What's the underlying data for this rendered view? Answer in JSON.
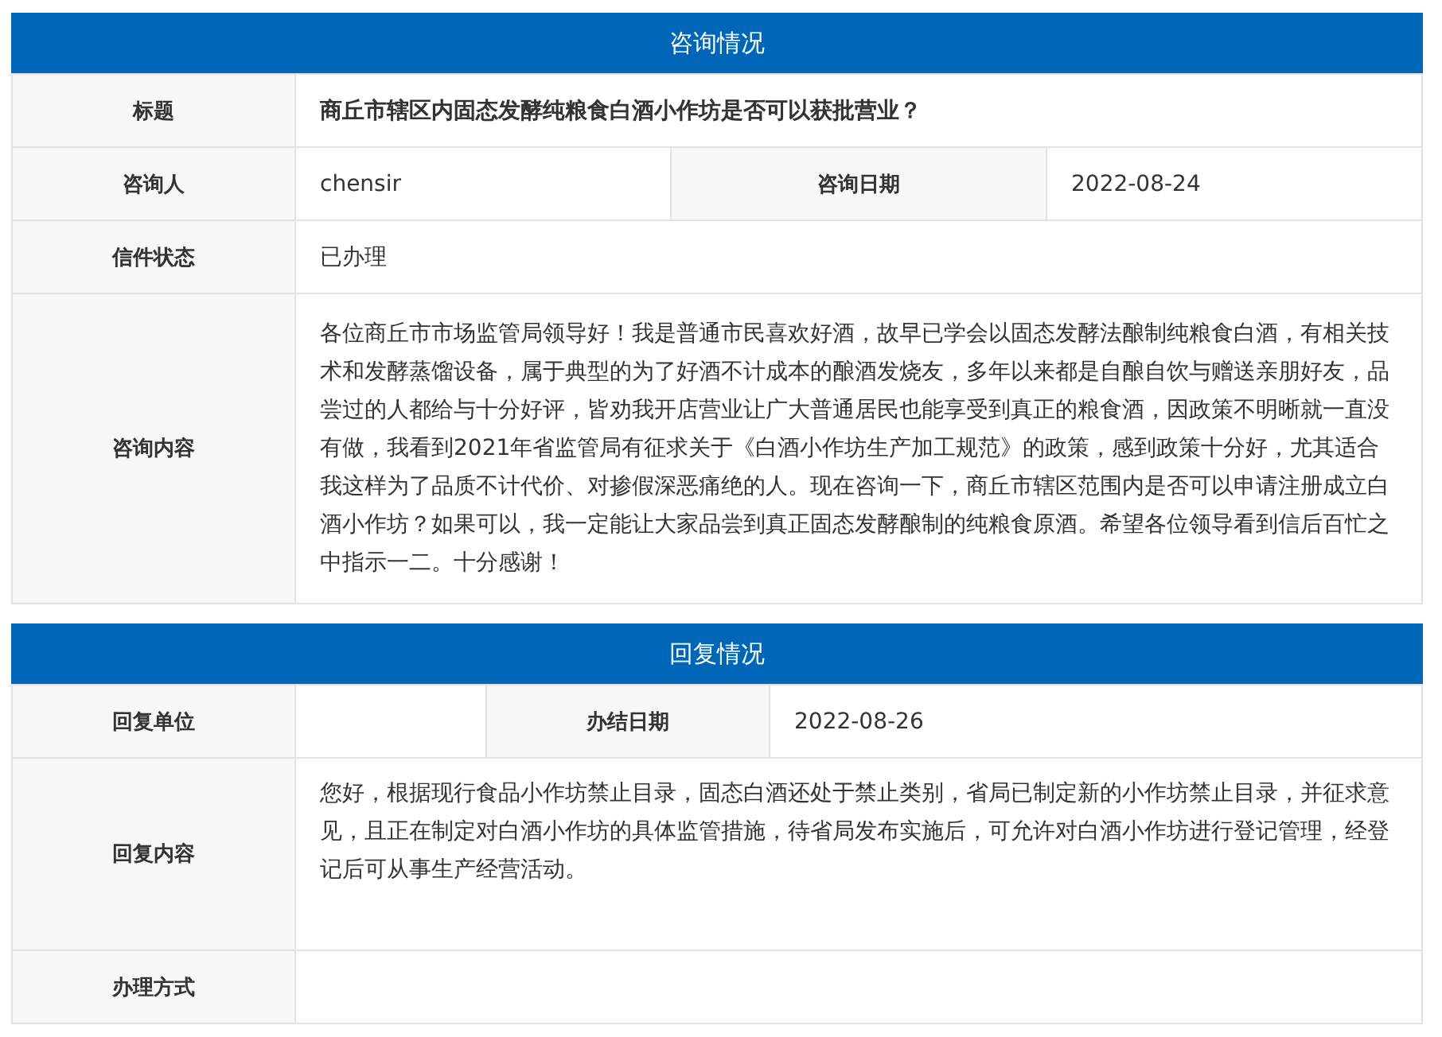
{
  "sections": [
    {
      "title": "咨询情况",
      "rows": [
        {
          "cells": [
            {
              "label": "标题",
              "value": "商丘市辖区内固态发酵纯粮食白酒小作坊是否可以获批营业？",
              "bold": true
            }
          ]
        },
        {
          "cells": [
            {
              "label": "咨询人",
              "value": "chensir"
            },
            {
              "label": "咨询日期",
              "value": "2022-08-24"
            }
          ]
        },
        {
          "cells": [
            {
              "label": "信件状态",
              "value": "已办理"
            }
          ]
        },
        {
          "cells": [
            {
              "label": "咨询内容",
              "value": "各位商丘市市场监管局领导好！我是普通市民喜欢好酒，故早已学会以固态发酵法酿制纯粮食白酒，有相关技术和发酵蒸馏设备，属于典型的为了好酒不计成本的酿酒发烧友，多年以来都是自酿自饮与赠送亲朋好友，品尝过的人都给与十分好评，皆劝我开店营业让广大普通居民也能享受到真正的粮食酒，因政策不明晰就一直没有做，我看到2021年省监管局有征求关于《白酒小作坊生产加工规范》的政策，感到政策十分好，尤其适合我这样为了品质不计代价、对掺假深恶痛绝的人。现在咨询一下，商丘市辖区范围内是否可以申请注册成立白酒小作坊？如果可以，我一定能让大家品尝到真正固态发酵酿制的纯粮食原酒。希望各位领导看到信后百忙之中指示一二。十分感谢！",
              "kind": "long"
            }
          ]
        }
      ]
    },
    {
      "title": "回复情况",
      "rows": [
        {
          "cells": [
            {
              "label": "回复单位"
            },
            {
              "label": "办结日期",
              "value": "2022-08-26"
            }
          ]
        },
        {
          "cells": [
            {
              "label": "回复内容",
              "value": "您好，根据现行食品小作坊禁止目录，固态白酒还处于禁止类别，省局已制定新的小作坊禁止目录，并征求意见，且正在制定对白酒小作坊的具体监管措施，待省局发布实施后，可允许对白酒小作坊进行登记管理，经登记后可从事生产经营活动。",
              "kind": "reply"
            }
          ]
        },
        {
          "cells": [
            {
              "label": "办理方式"
            }
          ]
        }
      ]
    }
  ]
}
